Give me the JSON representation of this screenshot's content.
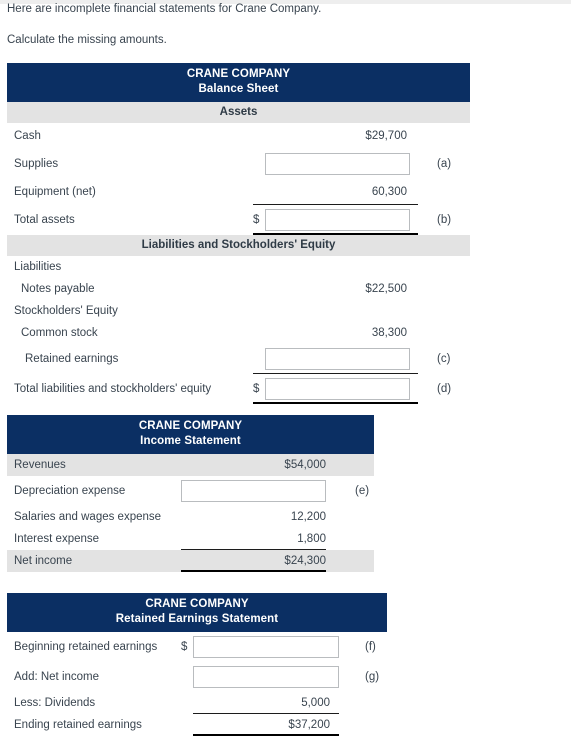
{
  "intro": {
    "line1": "Here are incomplete financial statements for Crane Company.",
    "line2": "Calculate the missing amounts."
  },
  "balance_sheet": {
    "company": "CRANE COMPANY",
    "title": "Balance Sheet",
    "assets_header": "Assets",
    "liabilities_header": "Liabilities and Stockholders' Equity",
    "dollar_sign": "$",
    "rows": [
      {
        "label": "Cash",
        "amount": "$29,700",
        "tag": ""
      },
      {
        "label": "Supplies",
        "amount": "",
        "tag": "(a)",
        "input": true
      },
      {
        "label": "Equipment (net)",
        "amount": "60,300",
        "tag": ""
      },
      {
        "label": "Total assets",
        "amount": "",
        "tag": "(b)",
        "input": true
      },
      {
        "label": "Liabilities",
        "amount": "",
        "tag": ""
      },
      {
        "label": "Notes payable",
        "amount": "$22,500",
        "tag": ""
      },
      {
        "label": "Stockholders' Equity",
        "amount": "",
        "tag": ""
      },
      {
        "label": "Common stock",
        "amount": "38,300",
        "tag": ""
      },
      {
        "label": "Retained earnings",
        "amount": "",
        "tag": "(c)",
        "input": true
      },
      {
        "label": "Total liabilities and stockholders' equity",
        "amount": "",
        "tag": "(d)",
        "input": true
      }
    ]
  },
  "income_statement": {
    "company": "CRANE COMPANY",
    "title": "Income Statement",
    "rows": [
      {
        "label": "Revenues",
        "amount": "$54,000",
        "tag": ""
      },
      {
        "label": "Depreciation expense",
        "amount": "",
        "tag": "(e)",
        "input": true
      },
      {
        "label": "Salaries and wages expense",
        "amount": "12,200",
        "tag": ""
      },
      {
        "label": "Interest expense",
        "amount": "1,800",
        "tag": ""
      },
      {
        "label": "Net income",
        "amount": "$24,300",
        "tag": ""
      }
    ]
  },
  "retained_earnings": {
    "company": "CRANE COMPANY",
    "title": "Retained Earnings Statement",
    "dollar_sign": "$",
    "rows": [
      {
        "label": "Beginning retained earnings",
        "amount": "",
        "tag": "(f)",
        "input": true
      },
      {
        "label": "Add: Net income",
        "amount": "",
        "tag": "(g)",
        "input": true
      },
      {
        "label": "Less: Dividends",
        "amount": "5,000",
        "tag": ""
      },
      {
        "label": "Ending retained earnings",
        "amount": "$37,200",
        "tag": ""
      }
    ]
  }
}
